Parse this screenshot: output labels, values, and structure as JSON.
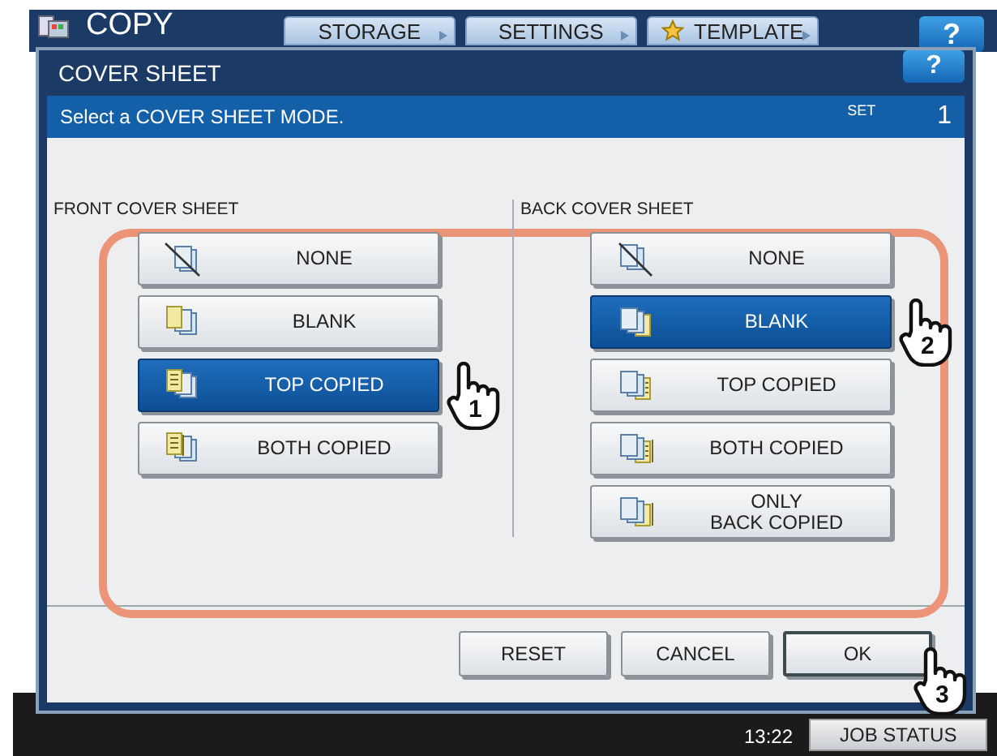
{
  "app": {
    "title": "COPY",
    "help_label": "?"
  },
  "top_tabs": [
    {
      "label": "STORAGE",
      "kind": "plain"
    },
    {
      "label": "SETTINGS",
      "kind": "plain"
    },
    {
      "label": "TEMPLATE",
      "kind": "star"
    }
  ],
  "dialog": {
    "title": "COVER SHEET",
    "help_label": "?",
    "instruction": "Select a COVER SHEET MODE.",
    "set_label": "SET",
    "set_count": "1"
  },
  "groups": [
    {
      "title": "FRONT COVER SHEET",
      "kind": "front",
      "options": [
        {
          "label": "NONE",
          "kind": "none",
          "selected": false
        },
        {
          "label": "BLANK",
          "kind": "blank",
          "selected": false
        },
        {
          "label": "TOP COPIED",
          "kind": "top",
          "selected": true,
          "callout": "1"
        },
        {
          "label": "BOTH COPIED",
          "kind": "both",
          "selected": false
        }
      ]
    },
    {
      "title": "BACK COVER SHEET",
      "kind": "back",
      "options": [
        {
          "label": "NONE",
          "kind": "none",
          "selected": false
        },
        {
          "label": "BLANK",
          "kind": "blank",
          "selected": true,
          "callout": "2"
        },
        {
          "label": "TOP COPIED",
          "kind": "top",
          "selected": false
        },
        {
          "label": "BOTH COPIED",
          "kind": "both",
          "selected": false
        },
        {
          "label": "ONLY\nBACK COPIED",
          "kind": "back",
          "selected": false
        }
      ]
    }
  ],
  "buttons": [
    {
      "label": "RESET",
      "default": false
    },
    {
      "label": "CANCEL",
      "default": false
    },
    {
      "label": "OK",
      "default": true,
      "callout": "3"
    }
  ],
  "status": {
    "time": "13:22",
    "job_status": "JOB STATUS"
  }
}
